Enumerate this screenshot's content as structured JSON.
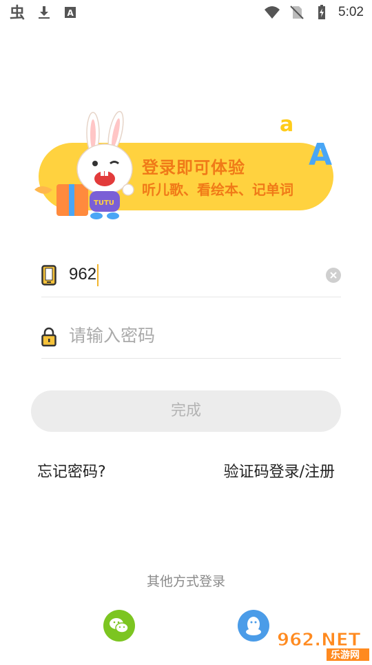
{
  "status_bar": {
    "time": "5:02",
    "left_icons": [
      "bug-icon",
      "download-icon",
      "font-icon"
    ],
    "right_icons": [
      "wifi-icon",
      "no-sim-icon",
      "battery-charging-icon"
    ]
  },
  "banner": {
    "line1": "登录即可体验",
    "line2": "听儿歌、看绘本、记单词",
    "mascot_shirt": "TUTU",
    "deco_letter_small": "a",
    "deco_letter_large": "A",
    "colors": {
      "pill": "#ffd23f",
      "text": "#f07a18"
    }
  },
  "form": {
    "phone_value": "962",
    "password_placeholder": "请输入密码",
    "submit_label": "完成"
  },
  "links": {
    "forgot_password": "忘记密码?",
    "code_login": "验证码登录/注册"
  },
  "other_login": {
    "label": "其他方式登录",
    "providers": [
      "wechat",
      "qq"
    ]
  },
  "watermark": {
    "brand": "962.NET",
    "subtitle": "乐游网"
  },
  "colors": {
    "accent": "#f2b42b",
    "button_bg": "#ececec",
    "wechat": "#7cc521",
    "qq": "#4b9ce8"
  }
}
